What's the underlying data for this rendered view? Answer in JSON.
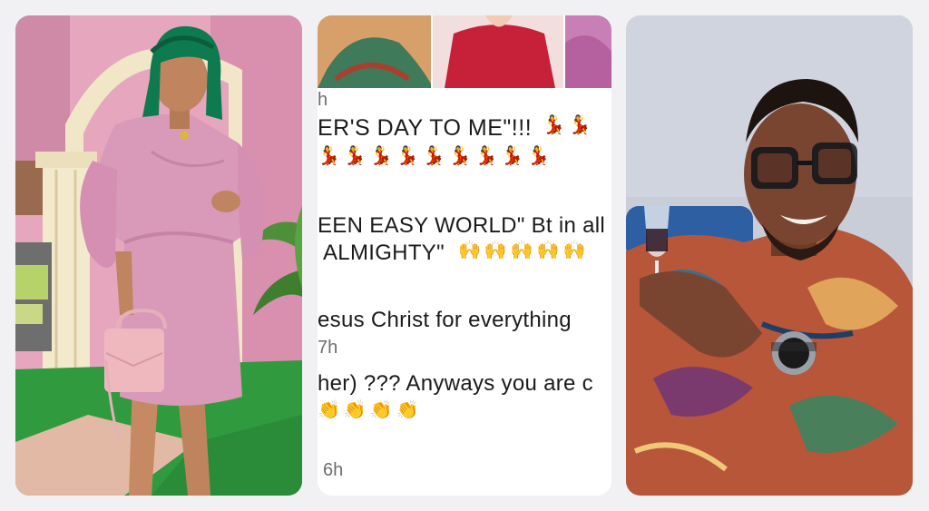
{
  "collage": {
    "left_photo": {
      "subject": "woman-in-pink-dress-icon"
    },
    "middle_screenshot": {
      "time_1": "h",
      "line_1": "ER'S DAY TO ME\"!!!",
      "line_2": "EEN EASY WORLD\" Bt in all",
      "line_3": "ALMIGHTY\"",
      "line_4": "esus Christ for everything",
      "time_2": "7h",
      "line_5": "her) ??? Anyways you are c",
      "time_3": "6h"
    },
    "right_photo": {
      "subject": "man-with-glasses-and-wine-glass-icon"
    }
  },
  "emoji": {
    "dancer": "💃",
    "raised_hands": "🙌",
    "clap": "👏"
  },
  "colors": {
    "background": "#f1f1f3",
    "dress": "#d89ab8",
    "wig": "#0e7a4f",
    "grass": "#2f9a3e",
    "shirt": "#b8563a"
  }
}
